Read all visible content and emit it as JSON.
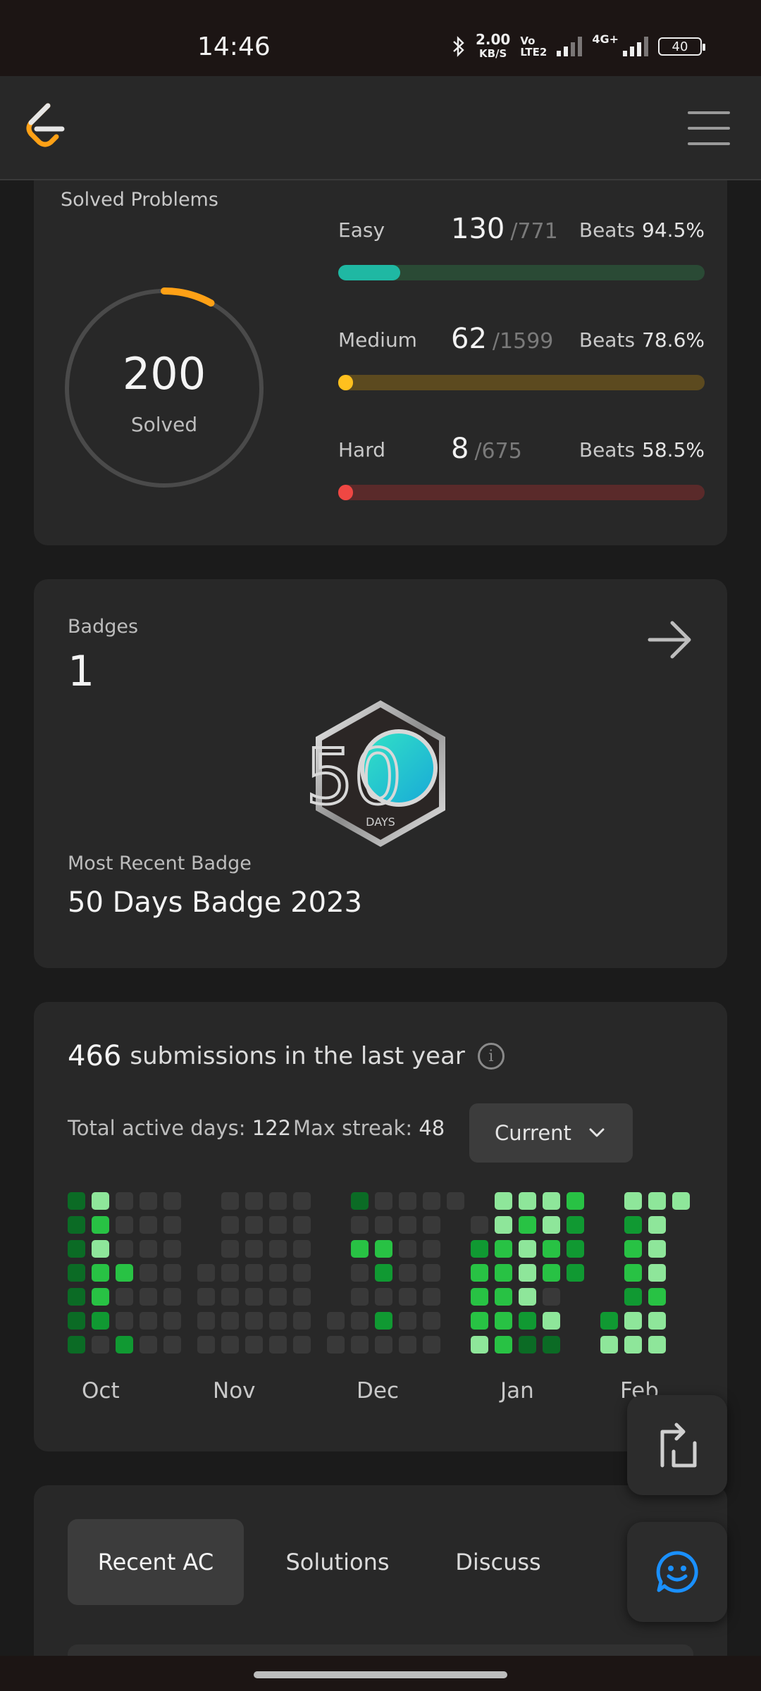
{
  "status_bar": {
    "time": "14:46",
    "net_speed_value": "2.00",
    "net_speed_unit": "KB/S",
    "volte_top": "Vo",
    "volte_bottom": "LTE2",
    "network": "4G+",
    "battery": "40"
  },
  "header": {
    "logo_icon": "leetcode-logo-icon",
    "menu_icon": "hamburger-menu-icon"
  },
  "solved": {
    "title": "Solved Problems",
    "total": "200",
    "total_label": "Solved",
    "ring_fraction": 0.08,
    "difficulties": [
      {
        "name": "Easy",
        "solved": "130",
        "total": "/771",
        "beats_label": "Beats",
        "beats": "94.5%",
        "fraction": 0.169,
        "track_color": "#2a4a35",
        "fill_color": "#1fb8a3"
      },
      {
        "name": "Medium",
        "solved": "62",
        "total": "/1599",
        "beats_label": "Beats",
        "beats": "78.6%",
        "fraction": 0.039,
        "track_color": "#5c4a1f",
        "fill_color": "#ffc01e"
      },
      {
        "name": "Hard",
        "solved": "8",
        "total": "/675",
        "beats_label": "Beats",
        "beats": "58.5%",
        "fraction": 0.012,
        "track_color": "#5a2a2a",
        "fill_color": "#ef4743"
      }
    ]
  },
  "badges": {
    "label": "Badges",
    "count": "1",
    "arrow_icon": "arrow-right-icon",
    "badge_number": "50",
    "badge_caption": "DAYS",
    "recent_label": "Most Recent Badge",
    "recent_name": "50 Days Badge 2023"
  },
  "submissions": {
    "count": "466",
    "label": "submissions in the last year",
    "info_icon": "info-icon",
    "active_days_label": "Total active days:",
    "active_days": "122",
    "max_streak_label": "Max streak:",
    "max_streak": "48",
    "dropdown_value": "Current",
    "months": [
      "Oct",
      "Nov",
      "Dec",
      "Jan",
      "Feb"
    ],
    "heatmap_colors": [
      "#393939",
      "#8ee69a",
      "#28c244",
      "#109932",
      "#0b6b25"
    ]
  },
  "tabs": {
    "items": [
      "Recent AC",
      "Solutions",
      "Discuss"
    ],
    "active": 0
  },
  "fabs": {
    "switch_icon": "switch-view-icon",
    "chat_icon": "chat-smile-icon"
  },
  "colors": {
    "background": "#1b1b1b",
    "card": "#282828",
    "accent_orange": "#ffa116",
    "chat_blue": "#1a90ff"
  }
}
